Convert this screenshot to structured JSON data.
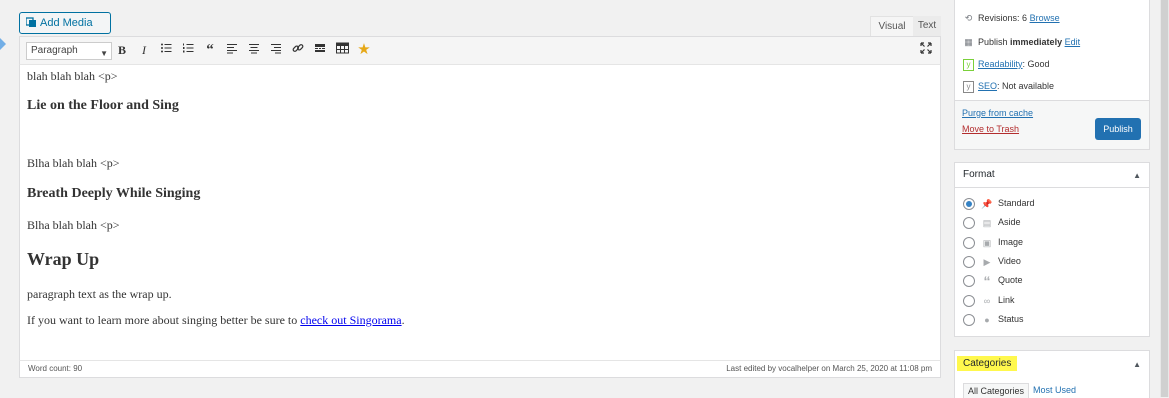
{
  "toolbar": {
    "add_media": "Add Media",
    "tab_visual": "Visual",
    "tab_text": "Text",
    "format_select": "Paragraph",
    "icons": [
      "bold-icon",
      "italic-icon",
      "bullet-list-icon",
      "numbered-list-icon",
      "blockquote-icon",
      "align-left-icon",
      "align-center-icon",
      "align-right-icon",
      "link-icon",
      "read-more-icon",
      "toolbar-toggle-icon",
      "star-icon",
      "fullscreen-icon"
    ]
  },
  "content": {
    "p1": "blah blah blah <p>",
    "h1": "Lie on the Floor and Sing",
    "p2": "Blha blah blah <p>",
    "h2": "Breath Deeply While Singing",
    "p3": "Blha blah blah <p>",
    "h3": "Wrap Up",
    "p4": "paragraph text as the wrap up.",
    "p5_before": "If you want to learn more about singing better be sure to ",
    "p5_link": "check out Singorama",
    "p5_after": "."
  },
  "status": {
    "word_count": "Word count: 90",
    "last_edited": "Last edited by vocalhelper on March 25, 2020 at 11:08 pm"
  },
  "publish": {
    "revisions_label": "Revisions:",
    "revisions_count": "6",
    "revisions_link": "Browse",
    "publish_label": "Publish",
    "publish_when": "immediately",
    "publish_edit": "Edit",
    "readability_link": "Readability",
    "readability_value": ": Good",
    "seo_link": "SEO",
    "seo_value": ": Not available",
    "purge": "Purge from cache",
    "trash": "Move to Trash",
    "publish_button": "Publish"
  },
  "format": {
    "title": "Format",
    "options": [
      {
        "label": "Standard",
        "icon": "pin-icon",
        "selected": true
      },
      {
        "label": "Aside",
        "icon": "aside-icon",
        "selected": false
      },
      {
        "label": "Image",
        "icon": "image-icon",
        "selected": false
      },
      {
        "label": "Video",
        "icon": "video-icon",
        "selected": false
      },
      {
        "label": "Quote",
        "icon": "quote-icon",
        "selected": false
      },
      {
        "label": "Link",
        "icon": "link-icon",
        "selected": false
      },
      {
        "label": "Status",
        "icon": "status-icon",
        "selected": false
      }
    ]
  },
  "categories": {
    "title": "Categories",
    "tab_all": "All Categories",
    "tab_used": "Most Used"
  },
  "colors": {
    "accent": "#2271b1",
    "highlight": "#fff84d",
    "trash": "#b32d2e"
  }
}
